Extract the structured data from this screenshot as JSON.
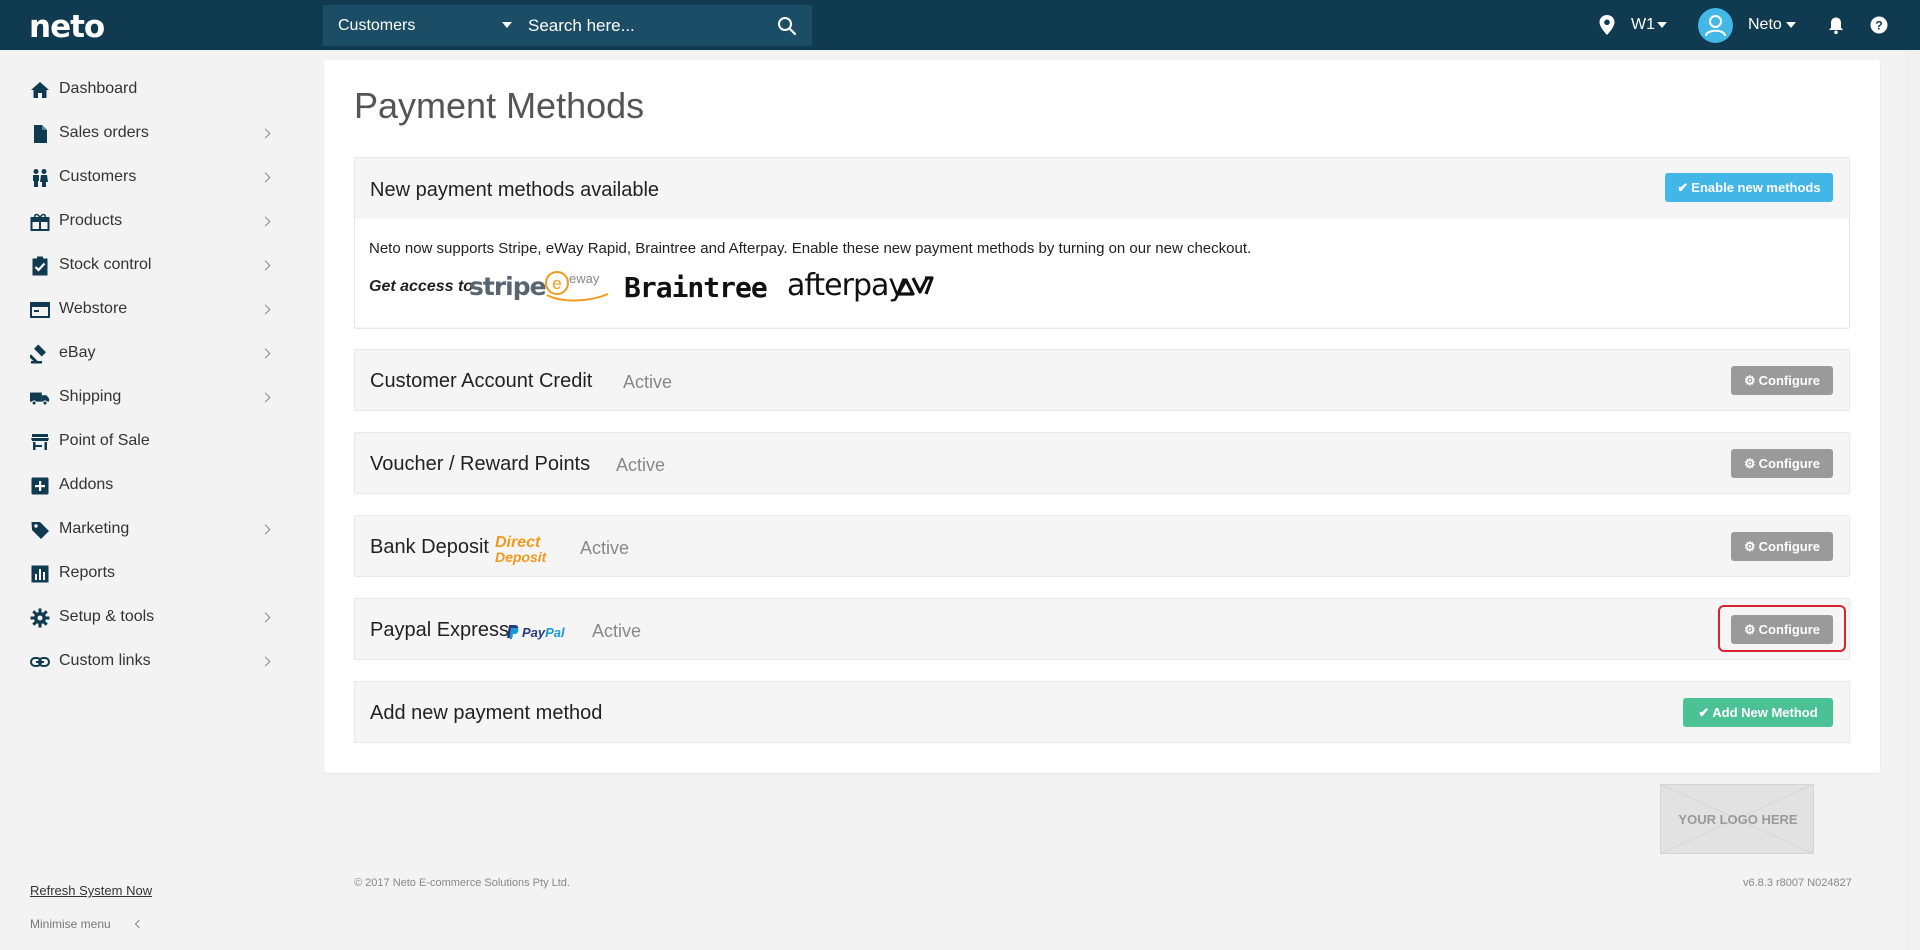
{
  "topbar": {
    "logo": "neto",
    "search_scope": "Customers",
    "search_placeholder": "Search here...",
    "location": "W1",
    "user": "Neto"
  },
  "sidebar": {
    "items": [
      {
        "label": "Dashboard",
        "icon": "home-icon",
        "chevron": false
      },
      {
        "label": "Sales orders",
        "icon": "document-icon",
        "chevron": true
      },
      {
        "label": "Customers",
        "icon": "people-icon",
        "chevron": true
      },
      {
        "label": "Products",
        "icon": "gift-icon",
        "chevron": true
      },
      {
        "label": "Stock control",
        "icon": "clipboard-check-icon",
        "chevron": true
      },
      {
        "label": "Webstore",
        "icon": "browser-icon",
        "chevron": true
      },
      {
        "label": "eBay",
        "icon": "gavel-icon",
        "chevron": true
      },
      {
        "label": "Shipping",
        "icon": "truck-icon",
        "chevron": true
      },
      {
        "label": "Point of Sale",
        "icon": "store-icon",
        "chevron": false
      },
      {
        "label": "Addons",
        "icon": "plus-box-icon",
        "chevron": false
      },
      {
        "label": "Marketing",
        "icon": "tag-icon",
        "chevron": true
      },
      {
        "label": "Reports",
        "icon": "bar-chart-icon",
        "chevron": false
      },
      {
        "label": "Setup & tools",
        "icon": "gear-icon",
        "chevron": true
      },
      {
        "label": "Custom links",
        "icon": "link-icon",
        "chevron": true
      }
    ],
    "refresh": "Refresh System Now",
    "minimise": "Minimise menu"
  },
  "main": {
    "title": "Payment Methods",
    "notice": {
      "title": "New payment methods available",
      "button": "Enable new methods",
      "text": "Neto now supports Stripe, eWay Rapid, Braintree and Afterpay. Enable these new payment methods by turning on our new checkout.",
      "get_access": "Get access to",
      "brands": {
        "stripe": "stripe",
        "eway": "eway",
        "braintree": "Braintree",
        "afterpay": "afterpay"
      }
    },
    "methods": [
      {
        "name": "Customer Account Credit",
        "status": "Active",
        "button": "Configure"
      },
      {
        "name": "Voucher / Reward Points",
        "status": "Active",
        "button": "Configure"
      },
      {
        "name": "Bank Deposit",
        "status": "Active",
        "button": "Configure",
        "badge_line1": "Direct",
        "badge_line2": "Deposit"
      },
      {
        "name": "Paypal Express",
        "status": "Active",
        "button": "Configure",
        "badge_line1": "Pay",
        "badge_line2": "Pal"
      }
    ],
    "add_new": {
      "title": "Add new payment method",
      "button": "Add New Method"
    }
  },
  "logo_placeholder": "YOUR LOGO HERE",
  "footer": {
    "copyright": "© 2017 Neto E-commerce Solutions Pty Ltd.",
    "version": "v6.8.3 r8007 N024827"
  },
  "colors": {
    "topbar": "#0f3a4f",
    "accent_blue": "#43b6e8",
    "configure_grey": "#9a9a9a",
    "add_green": "#4cc196",
    "highlight_red": "#d9232d"
  }
}
